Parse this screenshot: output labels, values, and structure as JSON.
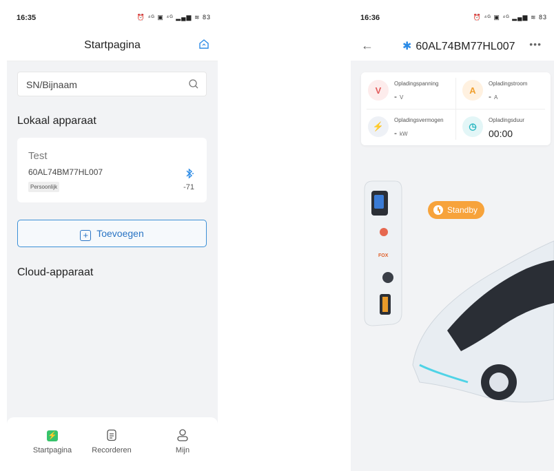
{
  "left": {
    "status": {
      "time": "16:35",
      "icons": "⏰ ⁴ᴳ ▣ ⁴ᴳ ▂▄▆ ≋ 83"
    },
    "nav": {
      "title": "Startpagina"
    },
    "search": {
      "placeholder": "SN/Bijnaam"
    },
    "local_section": "Lokaal apparaat",
    "device": {
      "name": "Test",
      "sn": "60AL74BM77HL007",
      "tag": "Persoonlijk",
      "rssi": "-71"
    },
    "add_label": "Toevoegen",
    "cloud_section": "Cloud-apparaat",
    "tabs": [
      {
        "label": "Startpagina",
        "icon": "lightning-square-icon",
        "active": true
      },
      {
        "label": "Recorderen",
        "icon": "document-icon",
        "active": false
      },
      {
        "label": "Mijn",
        "icon": "user-icon",
        "active": false
      }
    ]
  },
  "right": {
    "status": {
      "time": "16:36",
      "icons": "⏰ ⁴ᴳ ▣ ⁴ᴳ ▂▄▆ ≋ 83"
    },
    "nav": {
      "title": "60AL74BM77HL007"
    },
    "metrics": [
      {
        "label": "Opladingspanning",
        "value": "-",
        "unit": "V",
        "icon": "V",
        "color": "#e25c5c",
        "bg": "#fdecec"
      },
      {
        "label": "Opladingstroom",
        "value": "-",
        "unit": "A",
        "icon": "A",
        "color": "#f0a030",
        "bg": "#fff1e0"
      },
      {
        "label": "Opladingsvermogen",
        "value": "-",
        "unit": "kW",
        "icon": "⚡",
        "color": "#5a6b8a",
        "bg": "#eef1f6"
      },
      {
        "label": "Opladingsduur",
        "value": "00:00",
        "unit": "",
        "icon": "◷",
        "color": "#1fb4bf",
        "bg": "#e3f6f7"
      }
    ],
    "status_label": "Standby"
  },
  "colors": {
    "accent": "#2a74c4",
    "active_tab": "#37c36b",
    "standby": "#f7a33b"
  }
}
